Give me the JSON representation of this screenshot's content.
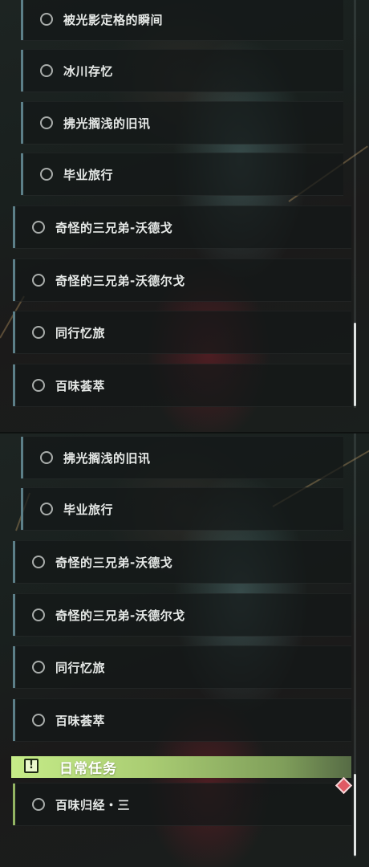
{
  "panel_top": {
    "items": [
      {
        "label": "被光影定格的瞬间"
      },
      {
        "label": "冰川存忆"
      },
      {
        "label": "拂光搁浅的旧讯"
      },
      {
        "label": "毕业旅行"
      },
      {
        "label": "奇怪的三兄弟-沃德戈"
      },
      {
        "label": "奇怪的三兄弟-沃德尔戈"
      },
      {
        "label": "同行忆旅"
      },
      {
        "label": "百味荟萃"
      }
    ]
  },
  "panel_bottom": {
    "items": [
      {
        "label": "拂光搁浅的旧讯"
      },
      {
        "label": "毕业旅行"
      },
      {
        "label": "奇怪的三兄弟-沃德戈"
      },
      {
        "label": "奇怪的三兄弟-沃德尔戈"
      },
      {
        "label": "同行忆旅"
      },
      {
        "label": "百味荟萃"
      }
    ],
    "daily_section": {
      "icon": "exclamation-icon",
      "title": "日常任务",
      "items": [
        {
          "label": "百味归经・三"
        }
      ]
    }
  },
  "colors": {
    "quest_accent": "#5c7f88",
    "daily_accent": "#93b463",
    "daily_header": "#c6ec88",
    "alert": "#e05a64"
  }
}
